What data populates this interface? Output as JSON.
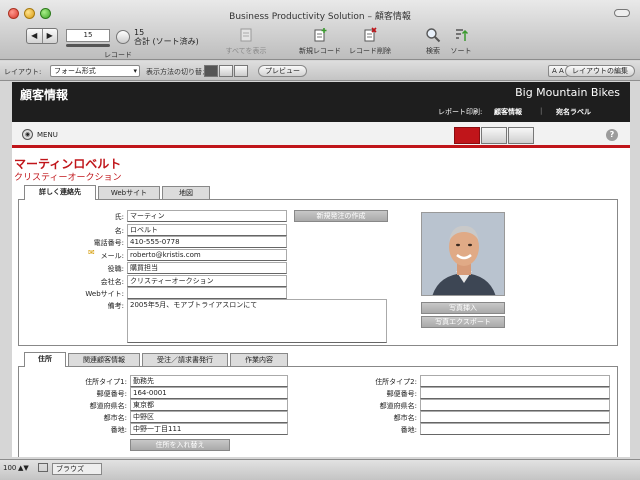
{
  "window": {
    "title": "Business Productivity Solution – 顧客情報"
  },
  "toolbar": {
    "record_number": "15",
    "record_count": "15",
    "record_state": "合計 (ソート済み)",
    "record_label": "レコード",
    "show_all": "すべてを表示",
    "new_record": "新規レコード",
    "delete_record": "レコード削除",
    "find": "検索",
    "sort": "ソート"
  },
  "layoutbar": {
    "layout_label": "レイアウト:",
    "layout_value": "フォーム形式",
    "view_label": "表示方法の切り替え:",
    "preview": "プレビュー",
    "font_size": "A A",
    "edit_layout": "レイアウトの編集"
  },
  "header": {
    "title": "顧客情報",
    "brand": "Big Mountain Bikes",
    "report_label": "レポート印刷:",
    "report_customer": "顧客情報",
    "report_label_print": "宛名ラベル"
  },
  "menu": {
    "label": "MENU",
    "help": "?"
  },
  "record": {
    "name": "マーティンロベルト",
    "company": "クリスティーオークション"
  },
  "tabs": [
    "詳しく連絡先",
    "Webサイト",
    "地図"
  ],
  "contact": {
    "last_name_label": "氏:",
    "last_name": "マーティン",
    "first_name_label": "名:",
    "first_name": "ロベルト",
    "phone_label": "電話番号:",
    "phone": "410-555-0778",
    "email_label": "メール:",
    "email": "roberto@kristis.com",
    "role_label": "役職:",
    "role": "購買担当",
    "company_label": "会社名:",
    "company": "クリスティーオークション",
    "website_label": "Webサイト:",
    "website": "",
    "notes_label": "備考:",
    "notes": "2005年5月、モアブトライアスロンにて",
    "new_order_button": "新規発注の作成",
    "photo_insert": "写真挿入",
    "photo_export": "写真エクスポート"
  },
  "bottom_tabs": [
    "住所",
    "関連顧客情報",
    "受注／請求書発行",
    "作業内容"
  ],
  "address": {
    "type1_label": "住所タイプ1:",
    "type1": "勤務先",
    "zip_label": "郵便番号:",
    "zip": "164-0001",
    "pref_label": "都道府県名:",
    "pref": "東京都",
    "city_label": "都市名:",
    "city": "中野区",
    "street_label": "番地:",
    "street": "中野一丁目111",
    "type2_label": "住所タイプ2:",
    "type2": "",
    "zip2_label": "郵便番号:",
    "zip2": "",
    "pref2_label": "都道府県名:",
    "pref2": "",
    "city2_label": "都市名:",
    "city2": "",
    "street2_label": "番地:",
    "street2": "",
    "swap_button": "住所を入れ替え"
  },
  "statusbar": {
    "zoom": "100",
    "mode": "ブラウズ"
  },
  "colors": {
    "accent": "#c0151a",
    "header_bg": "#1e1e1e"
  }
}
